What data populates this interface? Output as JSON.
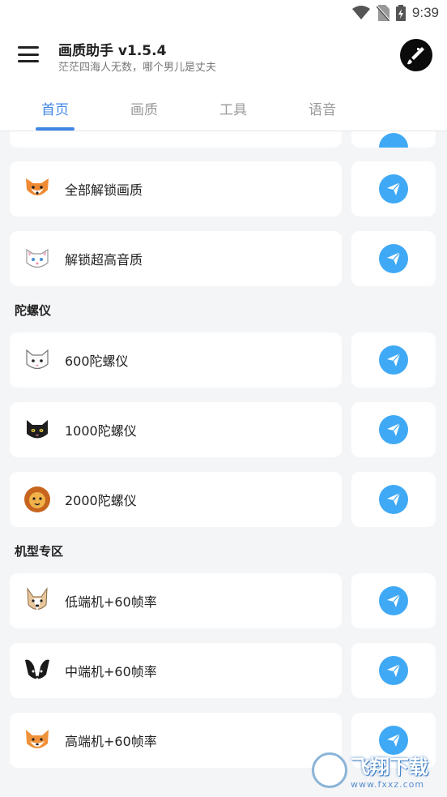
{
  "status_bar": {
    "time": "9:39"
  },
  "app": {
    "title": "画质助手 v1.5.4",
    "subtitle": "茫茫四海人无数，哪个男儿是丈夫"
  },
  "tabs": [
    {
      "label": "首页",
      "active": true
    },
    {
      "label": "画质",
      "active": false
    },
    {
      "label": "工具",
      "active": false
    },
    {
      "label": "语音",
      "active": false
    }
  ],
  "items_top": [
    {
      "label": "全部解锁画质",
      "icon": "fox-icon"
    },
    {
      "label": "解锁超高音质",
      "icon": "white-cat-icon"
    }
  ],
  "sections": [
    {
      "title": "陀螺仪",
      "items": [
        {
          "label": "600陀螺仪",
          "icon": "cat-icon"
        },
        {
          "label": "1000陀螺仪",
          "icon": "black-cat-icon"
        },
        {
          "label": "2000陀螺仪",
          "icon": "lion-icon"
        }
      ]
    },
    {
      "title": "机型专区",
      "items": [
        {
          "label": "低端机+60帧率",
          "icon": "dog-icon"
        },
        {
          "label": "中端机+60帧率",
          "icon": "papillon-dog-icon"
        },
        {
          "label": "高端机+60帧率",
          "icon": "shiba-icon"
        }
      ]
    }
  ],
  "watermark": {
    "main": "飞翔下载",
    "sub": "www.fxxz.com"
  },
  "colors": {
    "accent": "#3f86e6",
    "send_button": "#3fa9f5",
    "background": "#f4f5f7"
  }
}
